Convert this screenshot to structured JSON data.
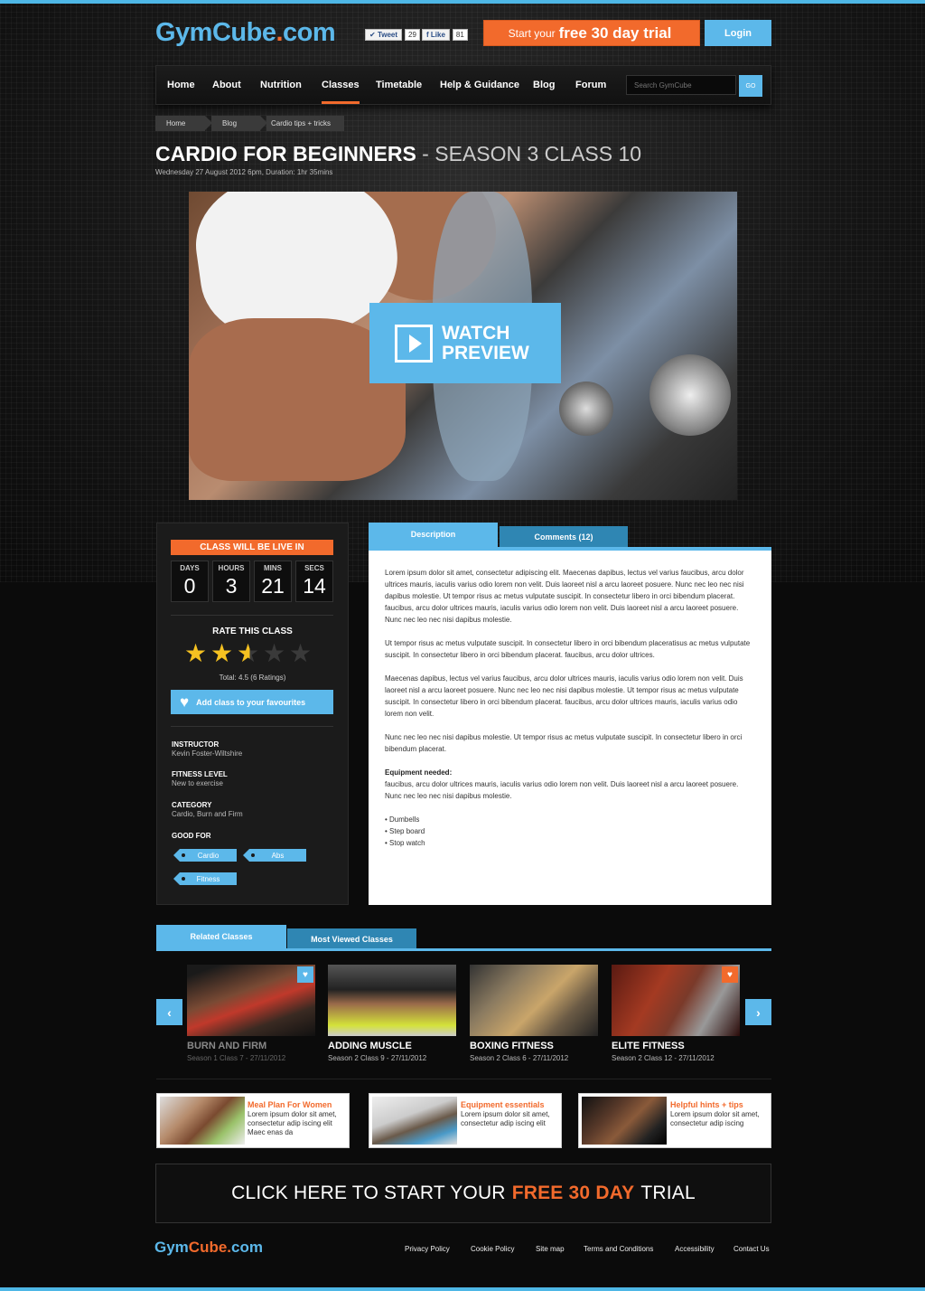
{
  "header": {
    "logo": {
      "gym": "Gym",
      "cube": "Cube",
      "dot": ".",
      "com": "com"
    },
    "tweet_label": "Tweet",
    "tweet_count": "29",
    "like_label": "Like",
    "like_count": "81",
    "trial_pre": "Start your",
    "trial_bold": "free 30 day trial",
    "login_label": "Login"
  },
  "nav": {
    "items": [
      "Home",
      "About",
      "Nutrition",
      "Classes",
      "Timetable",
      "Help & Guidance",
      "Blog",
      "Forum"
    ],
    "active": "Classes",
    "search_placeholder": "Search GymCube",
    "go_label": "GO"
  },
  "breadcrumb": [
    "Home",
    "Blog",
    "Cardio tips + tricks"
  ],
  "page": {
    "title_bold": "CARDIO FOR BEGINNERS",
    "title_rest": " - SEASON 3 CLASS 10",
    "date": "Wednesday 27 August 2012 6pm, Duration: 1hr 35mins"
  },
  "hero": {
    "watch_line1": "WATCH",
    "watch_line2": "PREVIEW"
  },
  "sidebar": {
    "live_label": "CLASS WILL BE LIVE IN",
    "countdown": [
      {
        "label": "DAYS",
        "value": "0"
      },
      {
        "label": "HOURS",
        "value": "3"
      },
      {
        "label": "MINS",
        "value": "21"
      },
      {
        "label": "SECS",
        "value": "14"
      }
    ],
    "rate_title": "RATE THIS CLASS",
    "rating": 2.5,
    "rating_max": 5,
    "total": "Total: 4.5 (6 Ratings)",
    "fav_label": "Add class to your favourites",
    "instructor_label": "INSTRUCTOR",
    "instructor": "Kevin Foster-Wiltshire",
    "level_label": "FITNESS LEVEL",
    "level": "New to exercise",
    "category_label": "CATEGORY",
    "category": "Cardio, Burn and Firm",
    "good_for_label": "GOOD FOR",
    "tags": [
      "Cardio",
      "Abs",
      "Fitness"
    ]
  },
  "tabs": {
    "description": "Description",
    "comments": "Comments (12)"
  },
  "description": {
    "p1": "Lorem ipsum dolor sit amet, consectetur adipiscing elit. Maecenas dapibus, lectus vel varius faucibus, arcu dolor ultrices mauris, iaculis varius odio lorem non velit. Duis laoreet nisl a arcu laoreet posuere. Nunc nec leo nec nisi dapibus molestie. Ut tempor risus ac metus vulputate suscipit. In consectetur libero in orci bibendum placerat. faucibus, arcu dolor ultrices mauris, iaculis varius odio lorem non velit. Duis laoreet nisl a arcu laoreet posuere. Nunc nec leo nec nisi dapibus molestie.",
    "p2": "Ut tempor risus ac metus vulputate suscipit. In consectetur libero in orci bibendum placeratisus ac metus vulputate suscipit. In consectetur libero in orci bibendum placerat. faucibus, arcu dolor ultrices.",
    "p3": "Maecenas dapibus, lectus vel varius faucibus, arcu dolor ultrices mauris, iaculis varius odio lorem non velit. Duis laoreet nisl a arcu laoreet posuere. Nunc nec leo nec nisi dapibus molestie. Ut tempor risus ac metus vulputate suscipit. In consectetur libero in orci bibendum placerat. faucibus, arcu dolor ultrices mauris, iaculis varius odio lorem non velit.",
    "p4": "Nunc nec leo nec nisi dapibus molestie. Ut tempor risus ac metus vulputate suscipit. In consectetur libero in orci bibendum placerat.",
    "equipment_label": "Equipment needed:",
    "equipment_text": "faucibus, arcu dolor ultrices mauris, iaculis varius odio lorem non velit. Duis laoreet nisl a arcu laoreet posuere. Nunc nec leo nec nisi dapibus molestie.",
    "bullets": [
      "• Dumbells",
      "• Step board",
      "• Stop watch"
    ]
  },
  "related": {
    "tab_related": "Related Classes",
    "tab_viewed": "Most Viewed Classes",
    "items": [
      {
        "name": "BURN AND FIRM",
        "sub": "Season 1 Class 7 - 27/11/2012"
      },
      {
        "name": "ADDING MUSCLE",
        "sub": "Season 2 Class 9 - 27/11/2012"
      },
      {
        "name": "BOXING FITNESS",
        "sub": "Season 2 Class 6 - 27/11/2012"
      },
      {
        "name": "ELITE FITNESS",
        "sub": "Season 2 Class 12 - 27/11/2012"
      }
    ]
  },
  "promos": [
    {
      "title": "Meal Plan For Women",
      "body": "Lorem ipsum dolor sit amet, consectetur adip iscing elit Maec enas da"
    },
    {
      "title": "Equipment essentials",
      "body": "Lorem ipsum dolor sit amet, consectetur adip iscing elit"
    },
    {
      "title": "Helpful hints + tips",
      "body": "Lorem ipsum dolor sit amet, consectetur adip iscing"
    }
  ],
  "cta": {
    "pre": "CLICK HERE TO START YOUR",
    "bold": "FREE 30 DAY",
    "post": "TRIAL"
  },
  "footer": {
    "links": [
      "Privacy Policy",
      "Cookie Policy",
      "Site map",
      "Terms and Conditions",
      "Accessibility",
      "Contact Us"
    ]
  },
  "colors": {
    "accent_blue": "#5cb8ea",
    "accent_orange": "#f26a2c",
    "star": "#f6c221"
  }
}
